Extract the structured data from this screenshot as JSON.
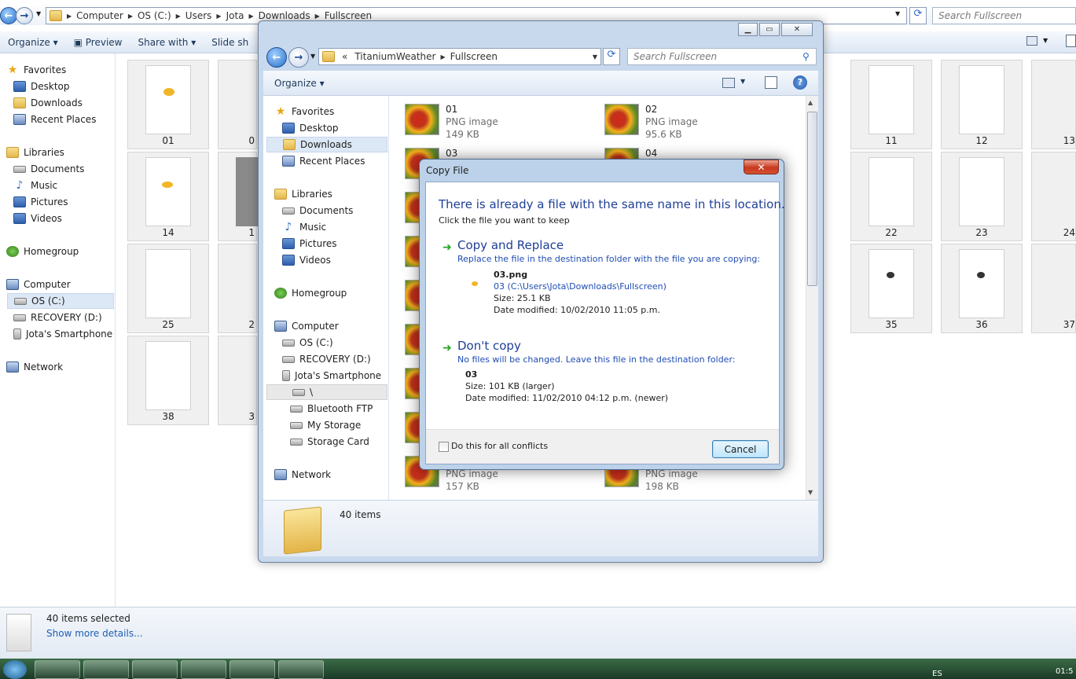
{
  "bg_window": {
    "address_crumbs": [
      "Computer",
      "OS (C:)",
      "Users",
      "Jota",
      "Downloads",
      "Fullscreen"
    ],
    "search_placeholder": "Search Fullscreen",
    "commands": {
      "organize": "Organize",
      "preview": "Preview",
      "share_with": "Share with",
      "slide_show": "Slide sh"
    },
    "nav": {
      "favorites": "Favorites",
      "desktop": "Desktop",
      "downloads": "Downloads",
      "recent": "Recent Places",
      "libraries": "Libraries",
      "documents": "Documents",
      "music": "Music",
      "pictures": "Pictures",
      "videos": "Videos",
      "homegroup": "Homegroup",
      "computer": "Computer",
      "os_c": "OS (C:)",
      "recovery": "RECOVERY (D:)",
      "smartphone": "Jota's Smartphone",
      "network": "Network"
    },
    "thumbs": {
      "t01": "01",
      "t02": "0",
      "t11": "11",
      "t12": "12",
      "t13": "13",
      "t14": "14",
      "t15": "1",
      "t22": "22",
      "t23": "23",
      "t24": "24",
      "t25": "25",
      "t26": "2",
      "t35": "35",
      "t36": "36",
      "t37": "37",
      "t38": "38",
      "t39": "3"
    },
    "details": {
      "selected": "40 items selected",
      "more": "Show more details..."
    }
  },
  "front_window": {
    "address_prefix": "«",
    "address_crumbs": [
      "TitaniumWeather",
      "Fullscreen"
    ],
    "search_placeholder": "Search Fullscreen",
    "organize": "Organize",
    "nav": {
      "favorites": "Favorites",
      "desktop": "Desktop",
      "downloads": "Downloads",
      "recent": "Recent Places",
      "libraries": "Libraries",
      "documents": "Documents",
      "music": "Music",
      "pictures": "Pictures",
      "videos": "Videos",
      "homegroup": "Homegroup",
      "computer": "Computer",
      "os_c": "OS (C:)",
      "recovery": "RECOVERY (D:)",
      "smartphone": "Jota's Smartphone",
      "root": "\\",
      "bt": "Bluetooth FTP",
      "storage": "My Storage",
      "card": "Storage Card",
      "network": "Network"
    },
    "files": [
      {
        "name": "01",
        "type": "PNG image",
        "size": "149 KB"
      },
      {
        "name": "02",
        "type": "PNG image",
        "size": "95.6 KB"
      },
      {
        "name": "03",
        "type": "",
        "size": ""
      },
      {
        "name": "04",
        "type": "",
        "size": ""
      },
      {
        "name": "",
        "type": "PNG image",
        "size": "157 KB"
      },
      {
        "name": "",
        "type": "PNG image",
        "size": "198 KB"
      }
    ],
    "item_count": "40 items"
  },
  "dialog": {
    "title": "Copy File",
    "close": "✕",
    "heading": "There is already a file with the same name in this location.",
    "sub": "Click the file you want to keep",
    "replace": {
      "title": "Copy and Replace",
      "desc": "Replace the file in the destination folder with the file you are copying:",
      "filename": "03.png",
      "path": "03 (C:\\Users\\Jota\\Downloads\\Fullscreen)",
      "size": "Size: 25.1 KB",
      "date": "Date modified: 10/02/2010 11:05 p.m."
    },
    "dontcopy": {
      "title": "Don't copy",
      "desc": "No files will be changed. Leave this file in the destination folder:",
      "filename": "03",
      "size": "Size: 101 KB (larger)",
      "date": "Date modified: 11/02/2010 04:12 p.m. (newer)"
    },
    "checkbox": "Do this for all conflicts",
    "cancel": "Cancel"
  },
  "taskbar": {
    "lang": "ES",
    "time": "01:5"
  }
}
